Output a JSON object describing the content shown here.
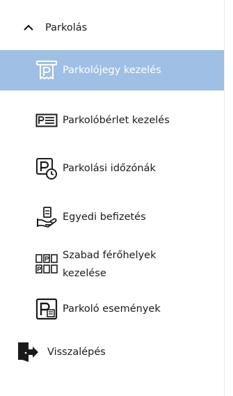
{
  "menu": {
    "group": {
      "label": "Parkolás",
      "expanded": true,
      "chevron_icon": "chevron-up-icon"
    },
    "items": [
      {
        "label": "Parkolójegy kezelés",
        "icon": "parking-ticket-icon",
        "selected": true
      },
      {
        "label": "Parkolóbérlet kezelés",
        "icon": "parking-pass-card-icon",
        "selected": false
      },
      {
        "label": "Parkolási időzónák",
        "icon": "parking-clock-icon",
        "selected": false
      },
      {
        "label": "Egyedi befizetés",
        "icon": "hand-money-icon",
        "selected": false
      },
      {
        "label": "Szabad férőhelyek kezelése",
        "icon": "free-spaces-grid-icon",
        "selected": false
      },
      {
        "label": "Parkoló események",
        "icon": "parking-event-icon",
        "selected": false
      }
    ],
    "back": {
      "label": "Visszalépés",
      "icon": "exit-door-icon"
    }
  },
  "colors": {
    "selected_background": "#9fbfe4",
    "selected_text": "#ffffff",
    "text": "#1a1a1a"
  }
}
